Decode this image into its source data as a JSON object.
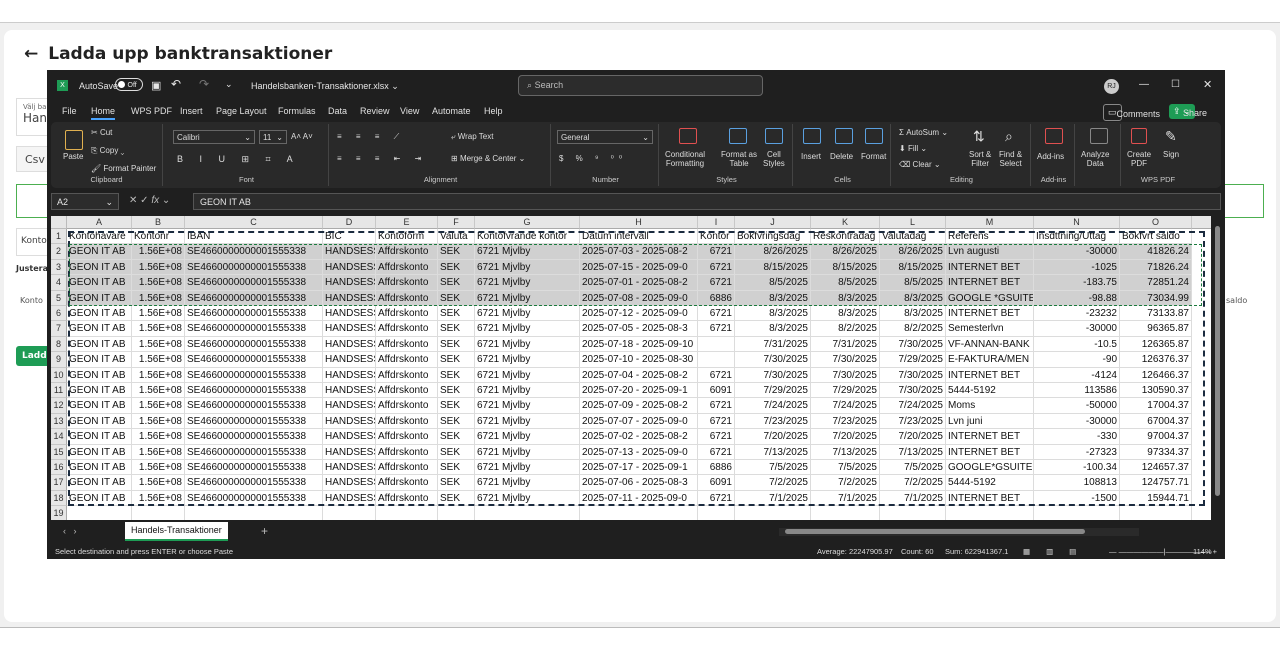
{
  "background": {
    "title": "Ladda upp banktransaktioner",
    "field1_label": "Välj ba",
    "field1_value": "Hand",
    "field2": "Csv",
    "field3": "Konto",
    "field4": "Justera",
    "field5": "Konto",
    "button": "Ladda",
    "right_saldo": "saldo"
  },
  "titlebar": {
    "autosave": "AutoSave",
    "toggle": "Off",
    "filename": "Handelsbanken-Transaktioner.xlsx",
    "search": "Search",
    "avatar": "RJ"
  },
  "menu": [
    "File",
    "Home",
    "WPS PDF",
    "Insert",
    "Page Layout",
    "Formulas",
    "Data",
    "Review",
    "View",
    "Automate",
    "Help"
  ],
  "menu_right": {
    "comments": "Comments",
    "share": "Share"
  },
  "ribbon": {
    "paste": "Paste",
    "cut": "Cut",
    "copy": "Copy",
    "painter": "Format Painter",
    "clipboard": "Clipboard",
    "font_name": "Calibri",
    "font_size": "11",
    "font": "Font",
    "wrap": "Wrap Text",
    "merge": "Merge & Center",
    "alignment": "Alignment",
    "numfmt": "General",
    "number": "Number",
    "cond1": "Conditional",
    "cond2": "Formatting",
    "fmt1": "Format as",
    "fmt2": "Table",
    "cell1": "Cell",
    "cell2": "Styles",
    "styles": "Styles",
    "insert": "Insert",
    "delete": "Delete",
    "format": "Format",
    "cells": "Cells",
    "autosum": "AutoSum",
    "fill": "Fill",
    "clear": "Clear",
    "sort1": "Sort &",
    "sort2": "Filter",
    "find1": "Find &",
    "find2": "Select",
    "editing": "Editing",
    "addins": "Add-ins",
    "addins_g": "Add-ins",
    "analyze1": "Analyze",
    "analyze2": "Data",
    "create1": "Create",
    "create2": "PDF",
    "sign": "Sign",
    "wps": "WPS PDF"
  },
  "formula": {
    "namebox": "A2",
    "value": "GEON IT AB",
    "fx": "fx"
  },
  "columns": [
    "A",
    "B",
    "C",
    "D",
    "E",
    "F",
    "G",
    "H",
    "I",
    "J",
    "K",
    "L",
    "M",
    "N",
    "O"
  ],
  "headers": [
    "Kontohavare",
    "Kontonr",
    "IBAN",
    "BIC",
    "Kontoform",
    "Valuta",
    "Kontofvrande kontor",
    "Datum intervall",
    "Kontor",
    "Bokfvringsdag",
    "Reskontradag",
    "Valutadag",
    "Referens",
    "Insdttning/Uttag",
    "Bokfvrt saldo"
  ],
  "rows": [
    [
      "GEON IT AB",
      "1.56E+08",
      "SE4660000000001555338",
      "HANDSESS",
      "Affdrskonto",
      "SEK",
      "6721 Mjvlby",
      "2025-07-03 - 2025-08-2",
      "6721",
      "8/26/2025",
      "8/26/2025",
      "8/26/2025",
      "Lvn augusti",
      "-30000",
      "41826.24"
    ],
    [
      "GEON IT AB",
      "1.56E+08",
      "SE4660000000001555338",
      "HANDSESS",
      "Affdrskonto",
      "SEK",
      "6721 Mjvlby",
      "2025-07-15 - 2025-09-0",
      "6721",
      "8/15/2025",
      "8/15/2025",
      "8/15/2025",
      "INTERNET BET",
      "-1025",
      "71826.24"
    ],
    [
      "GEON IT AB",
      "1.56E+08",
      "SE4660000000001555338",
      "HANDSESS",
      "Affdrskonto",
      "SEK",
      "6721 Mjvlby",
      "2025-07-01 - 2025-08-2",
      "6721",
      "8/5/2025",
      "8/5/2025",
      "8/5/2025",
      "INTERNET BET",
      "-183.75",
      "72851.24"
    ],
    [
      "GEON IT AB",
      "1.56E+08",
      "SE4660000000001555338",
      "HANDSESS",
      "Affdrskonto",
      "SEK",
      "6721 Mjvlby",
      "2025-07-08 - 2025-09-0",
      "6886",
      "8/3/2025",
      "8/3/2025",
      "8/3/2025",
      "GOOGLE *GSUITE",
      "-98.88",
      "73034.99"
    ],
    [
      "GEON IT AB",
      "1.56E+08",
      "SE4660000000001555338",
      "HANDSESS",
      "Affdrskonto",
      "SEK",
      "6721 Mjvlby",
      "2025-07-12 - 2025-09-0",
      "6721",
      "8/3/2025",
      "8/3/2025",
      "8/3/2025",
      "INTERNET BET",
      "-23232",
      "73133.87"
    ],
    [
      "GEON IT AB",
      "1.56E+08",
      "SE4660000000001555338",
      "HANDSESS",
      "Affdrskonto",
      "SEK",
      "6721 Mjvlby",
      "2025-07-05 - 2025-08-3",
      "6721",
      "8/3/2025",
      "8/2/2025",
      "8/2/2025",
      "Semesterlvn",
      "-30000",
      "96365.87"
    ],
    [
      "GEON IT AB",
      "1.56E+08",
      "SE4660000000001555338",
      "HANDSESS",
      "Affdrskonto",
      "SEK",
      "6721 Mjvlby",
      "2025-07-18 - 2025-09-10",
      "",
      "7/31/2025",
      "7/31/2025",
      "7/30/2025",
      "VF-ANNAN-BANK",
      "-10.5",
      "126365.87"
    ],
    [
      "GEON IT AB",
      "1.56E+08",
      "SE4660000000001555338",
      "HANDSESS",
      "Affdrskonto",
      "SEK",
      "6721 Mjvlby",
      "2025-07-10 - 2025-08-30",
      "",
      "7/30/2025",
      "7/30/2025",
      "7/29/2025",
      "E-FAKTURA/MEN",
      "-90",
      "126376.37"
    ],
    [
      "GEON IT AB",
      "1.56E+08",
      "SE4660000000001555338",
      "HANDSESS",
      "Affdrskonto",
      "SEK",
      "6721 Mjvlby",
      "2025-07-04 - 2025-08-2",
      "6721",
      "7/30/2025",
      "7/30/2025",
      "7/30/2025",
      "INTERNET BET",
      "-4124",
      "126466.37"
    ],
    [
      "GEON IT AB",
      "1.56E+08",
      "SE4660000000001555338",
      "HANDSESS",
      "Affdrskonto",
      "SEK",
      "6721 Mjvlby",
      "2025-07-20 - 2025-09-1",
      "6091",
      "7/29/2025",
      "7/29/2025",
      "7/30/2025",
      "5444-5192",
      "113586",
      "130590.37"
    ],
    [
      "GEON IT AB",
      "1.56E+08",
      "SE4660000000001555338",
      "HANDSESS",
      "Affdrskonto",
      "SEK",
      "6721 Mjvlby",
      "2025-07-09 - 2025-08-2",
      "6721",
      "7/24/2025",
      "7/24/2025",
      "7/24/2025",
      "Moms",
      "-50000",
      "17004.37"
    ],
    [
      "GEON IT AB",
      "1.56E+08",
      "SE4660000000001555338",
      "HANDSESS",
      "Affdrskonto",
      "SEK",
      "6721 Mjvlby",
      "2025-07-07 - 2025-09-0",
      "6721",
      "7/23/2025",
      "7/23/2025",
      "7/23/2025",
      "Lvn juni",
      "-30000",
      "67004.37"
    ],
    [
      "GEON IT AB",
      "1.56E+08",
      "SE4660000000001555338",
      "HANDSESS",
      "Affdrskonto",
      "SEK",
      "6721 Mjvlby",
      "2025-07-02 - 2025-08-2",
      "6721",
      "7/20/2025",
      "7/20/2025",
      "7/20/2025",
      "INTERNET BET",
      "-330",
      "97004.37"
    ],
    [
      "GEON IT AB",
      "1.56E+08",
      "SE4660000000001555338",
      "HANDSESS",
      "Affdrskonto",
      "SEK",
      "6721 Mjvlby",
      "2025-07-13 - 2025-09-0",
      "6721",
      "7/13/2025",
      "7/13/2025",
      "7/13/2025",
      "INTERNET BET",
      "-27323",
      "97334.37"
    ],
    [
      "GEON IT AB",
      "1.56E+08",
      "SE4660000000001555338",
      "HANDSESS",
      "Affdrskonto",
      "SEK",
      "6721 Mjvlby",
      "2025-07-17 - 2025-09-1",
      "6886",
      "7/5/2025",
      "7/5/2025",
      "7/5/2025",
      "GOOGLE*GSUITE",
      "-100.34",
      "124657.37"
    ],
    [
      "GEON IT AB",
      "1.56E+08",
      "SE4660000000001555338",
      "HANDSESS",
      "Affdrskonto",
      "SEK",
      "6721 Mjvlby",
      "2025-07-06 - 2025-08-3",
      "6091",
      "7/2/2025",
      "7/2/2025",
      "7/2/2025",
      "5444-5192",
      "108813",
      "124757.71"
    ],
    [
      "GEON IT AB",
      "1.56E+08",
      "SE4660000000001555338",
      "HANDSESS",
      "Affdrskonto",
      "SEK",
      "6721 Mjvlby",
      "2025-07-11 - 2025-09-0",
      "6721",
      "7/1/2025",
      "7/1/2025",
      "7/1/2025",
      "INTERNET BET",
      "-1500",
      "15944.71"
    ]
  ],
  "row_numbers": [
    "1",
    "2",
    "3",
    "4",
    "5",
    "6",
    "7",
    "8",
    "9",
    "10",
    "11",
    "12",
    "13",
    "14",
    "15",
    "16",
    "17",
    "18",
    "19"
  ],
  "sheet_tab": "Handels-Transaktioner",
  "status": {
    "left": "Select destination and press ENTER or choose Paste",
    "average": "Average: 22247905.97",
    "count": "Count: 60",
    "sum": "Sum: 622941367.1",
    "zoom": "114%"
  }
}
